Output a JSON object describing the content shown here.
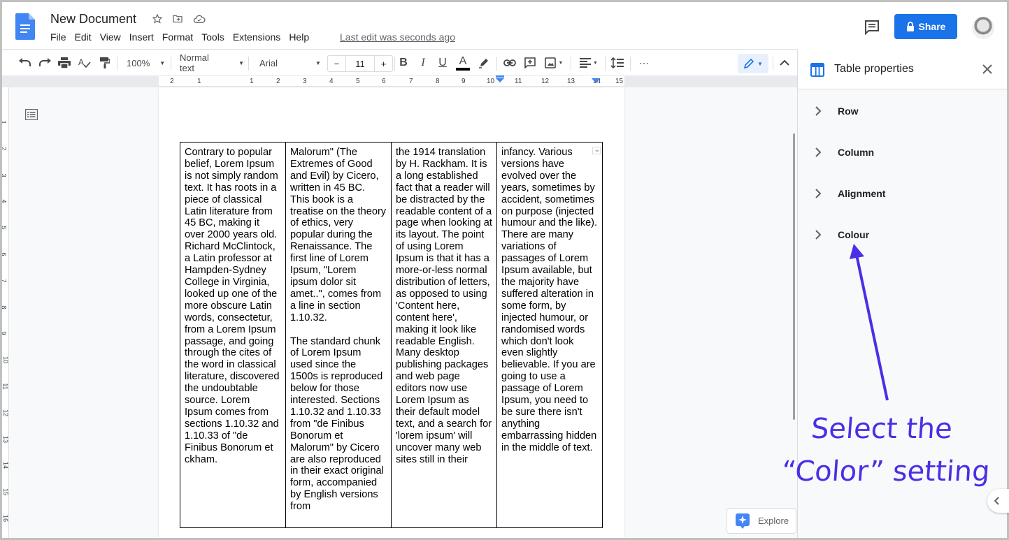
{
  "app": {
    "document_title": "New Document",
    "menu": [
      "File",
      "Edit",
      "View",
      "Insert",
      "Format",
      "Tools",
      "Extensions",
      "Help"
    ],
    "last_edit": "Last edit was seconds ago",
    "share_label": "Share"
  },
  "toolbar": {
    "zoom": "100%",
    "style": "Normal text",
    "font": "Arial",
    "font_size": "11",
    "minus": "−",
    "plus": "+",
    "bold": "B",
    "italic": "I",
    "underline": "U",
    "text_color_letter": "A",
    "more": "⋯"
  },
  "ruler": {
    "horizontal": [
      "2",
      "1",
      "1",
      "2",
      "3",
      "4",
      "5",
      "6",
      "7",
      "8",
      "9",
      "10",
      "11",
      "12",
      "13",
      "14",
      "15"
    ],
    "vertical": [
      "1",
      "2",
      "3",
      "4",
      "5",
      "6",
      "7",
      "8",
      "9",
      "10",
      "11",
      "12",
      "13",
      "14",
      "15",
      "16"
    ]
  },
  "table": {
    "cells": [
      "Contrary to popular\nbelief, Lorem Ipsum\nis not simply random\ntext. It has roots in a\npiece of classical\nLatin literature from\n45 BC, making it\nover 2000 years old.\nRichard McClintock,\na Latin professor at\nHampden-Sydney\nCollege in Virginia,\nlooked up one of the\nmore obscure Latin\nwords, consectetur,\nfrom a Lorem Ipsum\npassage, and going\nthrough the cites of\nthe word in classical\nliterature, discovered\nthe undoubtable\nsource. Lorem\nIpsum comes from\nsections 1.10.32 and\n1.10.33 of \"de\nFinibus Bonorum et\nckham.",
      "Malorum\" (The\nExtremes of Good\nand Evil) by Cicero,\nwritten in 45 BC.\nThis book is a\ntreatise on the theory\nof ethics, very\npopular during the\nRenaissance. The\nfirst line of Lorem\nIpsum, \"Lorem\nipsum dolor sit\namet..\", comes from\na line in section\n1.10.32.\n\nThe standard chunk\nof Lorem Ipsum\nused since the\n1500s is reproduced\nbelow for those\ninterested. Sections\n1.10.32 and 1.10.33\nfrom \"de Finibus\nBonorum et\nMalorum\" by Cicero\nare also reproduced\nin their exact original\nform, accompanied\nby English versions\nfrom",
      "the 1914 translation\nby H. Rackham. It is\na long established\nfact that a reader will\nbe distracted by the\nreadable content of a\npage when looking at\nits layout. The point\nof using Lorem\nIpsum is that it has a\nmore-or-less normal\ndistribution of letters,\nas opposed to using\n'Content here,\ncontent here',\nmaking it look like\nreadable English.\nMany desktop\npublishing packages\nand web page\neditors now use\nLorem Ipsum as\ntheir default model\ntext, and a search for\n'lorem ipsum' will\nuncover many web\nsites still in their",
      "infancy. Various\nversions have\nevolved over the\nyears, sometimes by\naccident, sometimes\non purpose (injected\nhumour and the like).\nThere are many\nvariations of\npassages of Lorem\nIpsum available, but\nthe majority have\nsuffered alteration in\nsome form, by\ninjected humour, or\nrandomised words\nwhich don't look\neven slightly\nbelievable. If you are\ngoing to use a\npassage of Lorem\nIpsum, you need to\nbe sure there isn't\nanything\nembarrassing hidden\nin the middle of text."
    ]
  },
  "side_panel": {
    "title": "Table properties",
    "sections": [
      "Row",
      "Column",
      "Alignment",
      "Colour"
    ]
  },
  "explore_label": "Explore",
  "annotation": {
    "line1": "Select the",
    "line2": "“Color” setting",
    "color": "#4b2ee6"
  },
  "colors": {
    "accent": "#1a73e8",
    "edit_mode_bg": "#e8f0fe"
  }
}
